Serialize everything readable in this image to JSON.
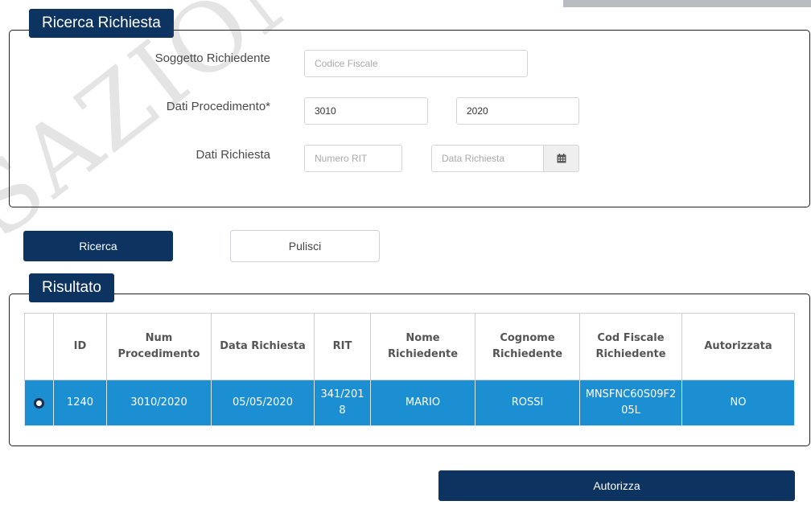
{
  "search": {
    "title": "Ricerca Richiesta",
    "soggetto_label": "Soggetto Richiedente",
    "codice_fiscale_placeholder": "Codice Fiscale",
    "procedimento_label": "Dati Procedimento*",
    "procedimento_num": "3010",
    "procedimento_anno": "2020",
    "richiesta_label": "Dati Richiesta",
    "numero_rit_placeholder": "Numero RIT",
    "data_richiesta_placeholder": "Data Richiesta",
    "calendar_icon": "calendar-icon"
  },
  "actions": {
    "ricerca": "Ricerca",
    "pulisci": "Pulisci",
    "autorizza": "Autorizza"
  },
  "results": {
    "title": "Risultato",
    "columns": [
      "",
      "ID",
      "Num Procedimento",
      "Data Richiesta",
      "RIT",
      "Nome Richiedente",
      "Cognome Richiedente",
      "Cod Fiscale Richiedente",
      "Autorizzata"
    ],
    "rows": [
      {
        "selected": true,
        "id": "1240",
        "num_procedimento": "3010/2020",
        "data_richiesta": "05/05/2020",
        "rit": "341/2018",
        "nome": "MARIO",
        "cognome": "ROSSI",
        "cod_fiscale": "MNSFNC60S09F205L",
        "autorizzata": "NO"
      }
    ]
  },
  "colors": {
    "primary": "#0d3360",
    "row_selected": "#1b8fd2"
  }
}
